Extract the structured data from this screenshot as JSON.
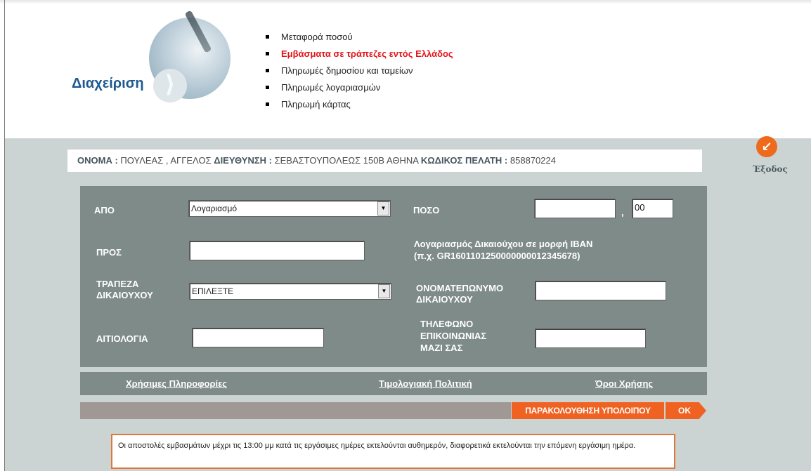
{
  "header": {
    "logo_title": "Διαχείριση",
    "logo_arrow": "⟩",
    "menu": [
      {
        "label": "Μεταφορά ποσού",
        "active": false
      },
      {
        "label": "Εμβάσματα σε τράπεζες εντός Ελλάδος",
        "active": true
      },
      {
        "label": "Πληρωμές δημοσίου και ταμείων",
        "active": false
      },
      {
        "label": "Πληρωμές λογαριασμών",
        "active": false
      },
      {
        "label": "Πληρωμή κάρτας",
        "active": false
      }
    ]
  },
  "customer": {
    "name_label": "ΟΝΟΜΑ :",
    "name_value": "ΠΟΥΛΕΑΣ , ΑΓΓΕΛΟΣ",
    "address_label": "ΔΙΕΥΘΥΝΣΗ :",
    "address_value": "ΣΕΒΑΣΤΟΥΠΟΛΕΩΣ 150Β ΑΘΗΝΑ",
    "code_label": "ΚΩΔΙΚΟΣ ΠΕΛΑΤΗ :",
    "code_value": "858870224"
  },
  "exit": {
    "icon": "↙",
    "label": "Έξοδος"
  },
  "form": {
    "from_label": "ΑΠΟ",
    "from_value": "Λογαριασμό",
    "amount_label": "ΠΟΣΟ",
    "amount_int_value": "",
    "amount_sep": ",",
    "amount_dec_value": "00",
    "to_label": "ΠΡΟΣ",
    "to_value": "",
    "iban_label_1": "Λογαριασμός Δικαιούχου σε μορφή IBAN",
    "iban_label_2": "(π.χ. GR1601101250000000012345678)",
    "bank_label_1": "ΤΡΑΠΕΖΑ",
    "bank_label_2": "ΔΙΚΑΙΟΥΧΟΥ",
    "bank_value": "ΕΠΙΛΕΞΤΕ",
    "beneficiary_label_1": "ΟΝΟΜΑΤΕΠΩΝΥΜΟ",
    "beneficiary_label_2": "ΔΙΚΑΙΟΥΧΟΥ",
    "beneficiary_value": "",
    "reason_label": "ΑΙΤΙΟΛΟΓΙΑ",
    "reason_value": "",
    "phone_label_1": "ΤΗΛΕΦΩΝΟ",
    "phone_label_2": "ΕΠΙΚΟΙΝΩΝΙΑΣ",
    "phone_label_3": "ΜΑΖΙ ΣΑΣ",
    "phone_value": "",
    "dropdown_arrow": "▼"
  },
  "links": {
    "useful_info": "Χρήσιμες Πληροφορίες",
    "pricing": "Τιμολογιακή Πολιτική",
    "terms": "Όροι Χρήσης"
  },
  "actions": {
    "track_balance": "ΠΑΡΑΚΟΛΟΥΘΗΣΗ ΥΠΟΛΟΙΠΟΥ",
    "ok": "OK"
  },
  "notice": {
    "text": "Οι αποστολές εμβασμάτων μέχρι τις 13:00 μμ κατά τις εργάσιμες ημέρες εκτελούνται αυθημερόν, διαφορετικά εκτελούνται την επόμενη εργάσιμη ημέρα."
  },
  "colors": {
    "accent": "#ef6222",
    "active_menu": "#e3141b",
    "panel": "#7f8b88",
    "band": "#ccd3d3",
    "logo_text": "#1d5a8f"
  }
}
